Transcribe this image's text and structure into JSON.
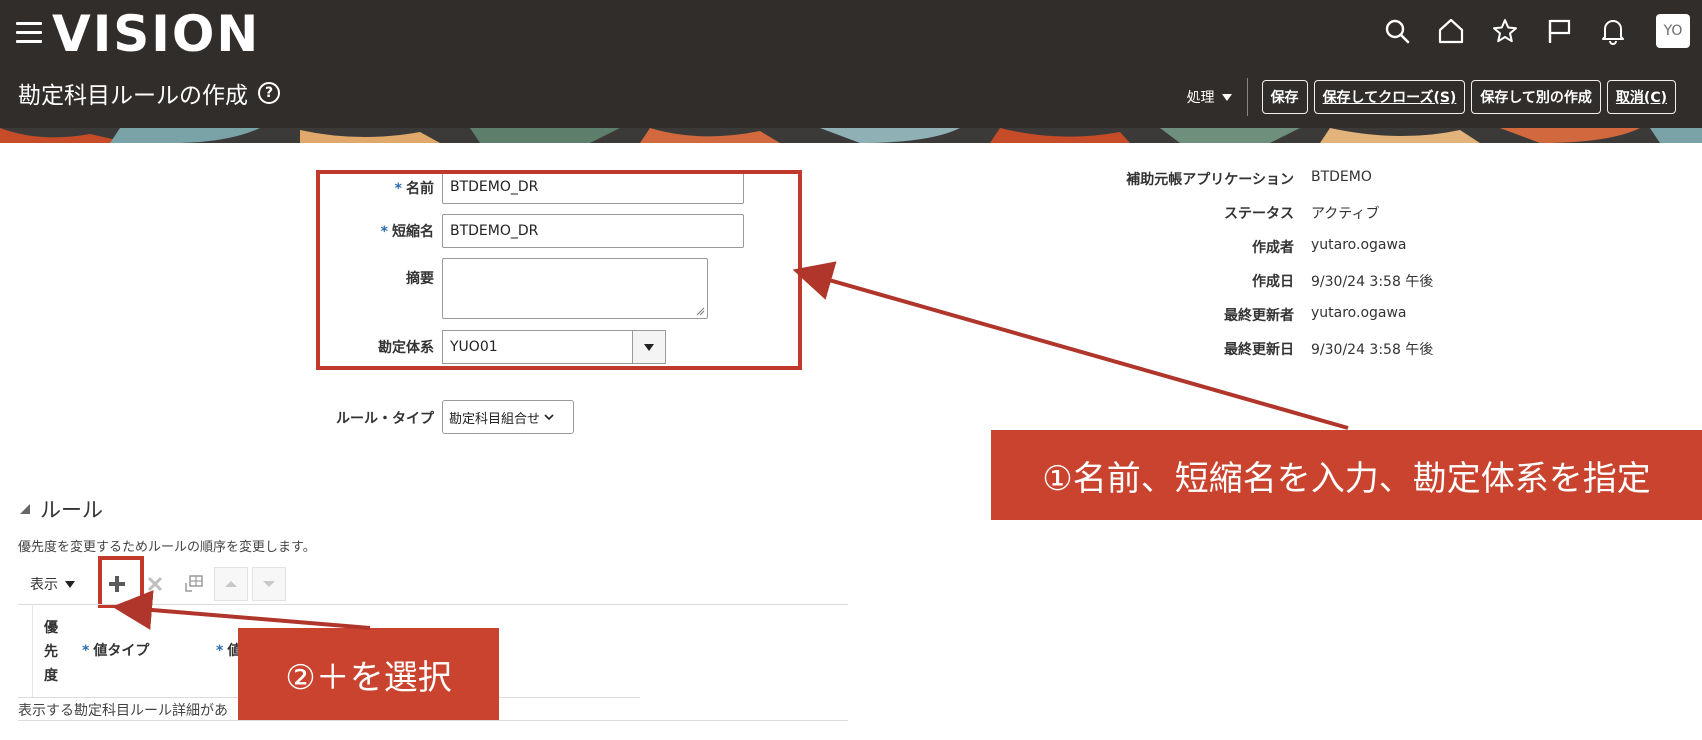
{
  "header": {
    "logo": "VISION",
    "page_title": "勘定科目ルールの作成",
    "help": "?",
    "avatar": "YO",
    "actions_label": "処理",
    "buttons": {
      "save": "保存",
      "save_close": "保存してクローズ(S)",
      "save_new": "保存して別の作成",
      "cancel": "取消(C)"
    }
  },
  "form": {
    "name_label": "名前",
    "name_value": "BTDEMO_DR",
    "short_name_label": "短縮名",
    "short_name_value": "BTDEMO_DR",
    "description_label": "摘要",
    "description_value": "",
    "coa_label": "勘定体系",
    "coa_value": "YUO01",
    "rule_type_label": "ルール・タイプ",
    "rule_type_value": "勘定科目組合せ",
    "required_mark": "*"
  },
  "info": {
    "items": [
      {
        "label": "補助元帳アプリケーション",
        "value": "BTDEMO"
      },
      {
        "label": "ステータス",
        "value": "アクティブ"
      },
      {
        "label": "作成者",
        "value": "yutaro.ogawa"
      },
      {
        "label": "作成日",
        "value": "9/30/24 3:58 午後"
      },
      {
        "label": "最終更新者",
        "value": "yutaro.ogawa"
      },
      {
        "label": "最終更新日",
        "value": "9/30/24 3:58 午後"
      }
    ]
  },
  "rules": {
    "title": "ルール",
    "description": "優先度を変更するためルールの順序を変更します。",
    "view_label": "表示",
    "columns": {
      "priority": "優\n先\n度",
      "value_type": "値タイプ",
      "value": "値"
    },
    "empty_message": "表示する勘定科目ルール詳細があ"
  },
  "callouts": {
    "step1": "①名前、短縮名を入力、勘定体系を指定",
    "step2": "②＋を選択"
  },
  "colors": {
    "header_bg": "#312d2a",
    "callout": "#c9432e",
    "highlight": "#c0392b",
    "required": "#2a6db5"
  }
}
